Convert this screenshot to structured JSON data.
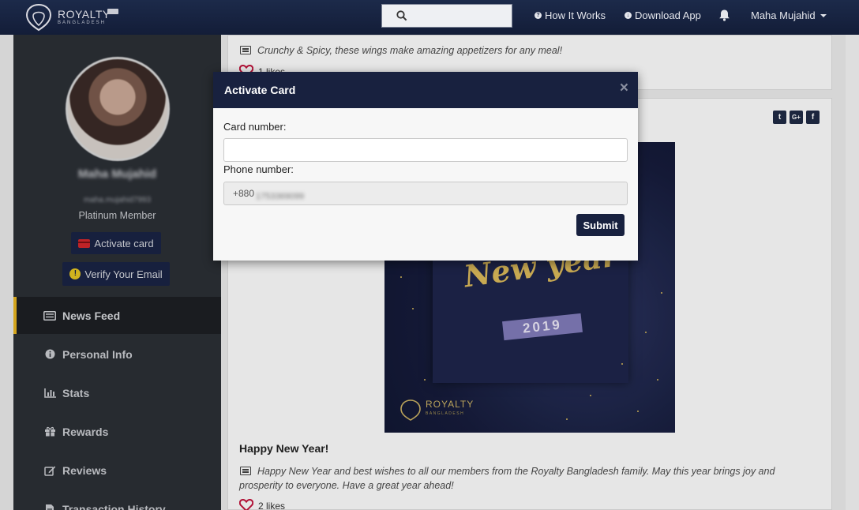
{
  "nav": {
    "logo_text": "ROYALTY",
    "logo_sub": "BANGLADESH",
    "how_it_works": "How It Works",
    "download_app": "Download App",
    "user_name": "Maha Mujahid"
  },
  "profile": {
    "name": "Maha Mujahid",
    "email": "maha.mujahid7993",
    "tier": "Platinum Member",
    "activate_card_label": "Activate card",
    "verify_email_label": "Verify Your Email"
  },
  "sidebar": {
    "items": [
      {
        "label": "News Feed"
      },
      {
        "label": "Personal Info"
      },
      {
        "label": "Stats"
      },
      {
        "label": "Rewards"
      },
      {
        "label": "Reviews"
      },
      {
        "label": "Transaction History"
      }
    ]
  },
  "feed": {
    "post1_text": "Crunchy & Spicy, these wings make amazing appetizers for any meal!",
    "post1_likes": "1 likes",
    "post2_image_title": "New year",
    "post2_image_year": "2019",
    "post2_image_brand": "ROYALTY",
    "post2_image_brand_sub": "BANGLADESH",
    "post2_title": "Happy New Year!",
    "post2_text_line1": "Happy New Year and best wishes to all our members from the Royalty Bangladesh family. May this year brings joy and",
    "post2_text_line2": "prosperity to everyone. Have a great year ahead!",
    "post2_likes": "2 likes"
  },
  "modal": {
    "title": "Activate Card",
    "close": "×",
    "card_label": "Card number:",
    "card_value": "",
    "phone_label": "Phone number:",
    "phone_prefix": "+880",
    "phone_rest": "1753369099",
    "submit_label": "Submit"
  },
  "colors": {
    "navy": "#18213f",
    "accent_gold": "#e6b420",
    "sidebar_bg": "#2b2f35"
  }
}
